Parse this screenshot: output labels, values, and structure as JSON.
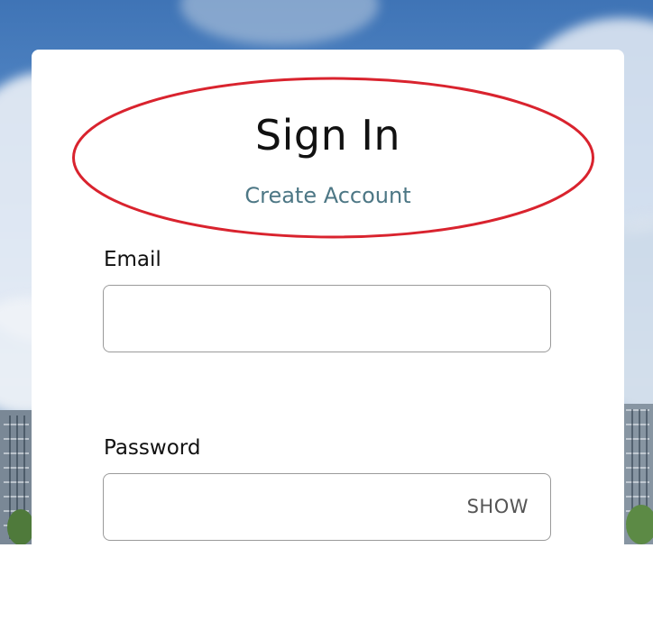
{
  "signin": {
    "title": "Sign In",
    "create_account_link": "Create Account",
    "email": {
      "label": "Email",
      "value": "",
      "placeholder": ""
    },
    "password": {
      "label": "Password",
      "value": "",
      "placeholder": "",
      "show_label": "SHOW"
    }
  },
  "annotation": {
    "highlight_color": "#d9232e"
  },
  "colors": {
    "link": "#4d7785",
    "text": "#111111",
    "border": "#9a9a9a"
  }
}
